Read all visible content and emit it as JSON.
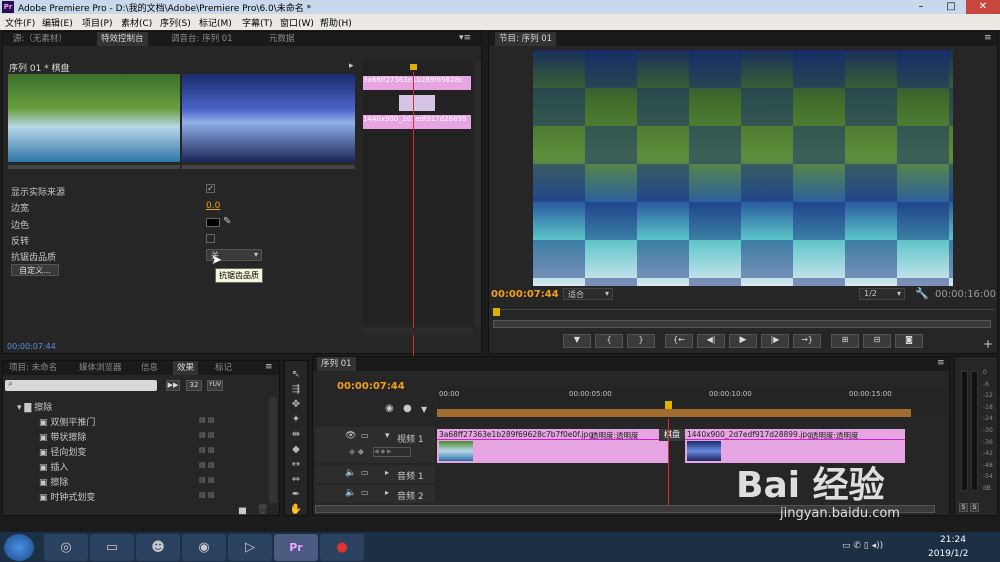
{
  "window": {
    "title": "Adobe Premiere Pro - D:\\我的文档\\Adobe\\Premiere Pro\\6.0\\未命名 *",
    "logo": "Pr"
  },
  "menu": [
    "文件(F)",
    "编辑(E)",
    "项目(P)",
    "素材(C)",
    "序列(S)",
    "标记(M)",
    "字幕(T)",
    "窗口(W)",
    "帮助(H)"
  ],
  "source_tabs": {
    "source": "源:（无素材）",
    "effect_controls": "特效控制台",
    "audio_mixer": "调音台: 序列 01",
    "metadata": "元数据"
  },
  "effect": {
    "header": "序列 01 * 棋盘",
    "clip_a": "3a68ff27363e1b289f69628c",
    "clip_b": "1440x900_2d7edf917d28899",
    "props": {
      "show_source": "显示实际来源",
      "border_width": "边宽",
      "border_width_value": "0.0",
      "border_color": "边色",
      "reverse": "反转",
      "aa_quality": "抗锯齿品质",
      "aa_value": "关",
      "custom": "自定义..."
    },
    "tooltip": "抗锯齿品质",
    "timecode": "00:00:07:44"
  },
  "program": {
    "tab": "节目: 序列 01",
    "timecode": "00:00:07:44",
    "fit": "适合",
    "resolution": "1/2",
    "duration": "00:00:16:00"
  },
  "project_tabs": {
    "project": "项目: 未命名",
    "media": "媒体浏览器",
    "info": "信息",
    "effects": "效果",
    "markers": "标记"
  },
  "effects_panel": {
    "buttons": [
      "32",
      "YUV"
    ],
    "folder": "擦除",
    "items": [
      "双侧平推门",
      "带状擦除",
      "径向划变",
      "插入",
      "擦除",
      "时钟式划变"
    ]
  },
  "timeline": {
    "tab": "序列 01",
    "timecode": "00:00:07:44",
    "ruler": [
      "00:00",
      "00:00:05:00",
      "00:00:10:00",
      "00:00:15:00"
    ],
    "video_track": "视频 1",
    "audio1": "音频 1",
    "audio2": "音频 2",
    "clip1": "3a68ff27363e1b289f69628c7b7f0e0f.jpg",
    "clip1_opacity": "透明度:透明度",
    "transition": "棋盘",
    "clip2": "1440x900_2d7edf917d28899.jpg",
    "clip2_opacity": "透明度:透明度"
  },
  "meter": {
    "labels": [
      "0",
      "-6",
      "-12",
      "-18",
      "-24",
      "-30",
      "-36",
      "-42",
      "-48",
      "-54",
      "dB"
    ],
    "solo": "S"
  },
  "taskbar": {
    "time": "21:24",
    "date": "2019/1/2"
  },
  "watermark": {
    "text": "Bai 经验",
    "url": "jingyan.baidu.com"
  }
}
